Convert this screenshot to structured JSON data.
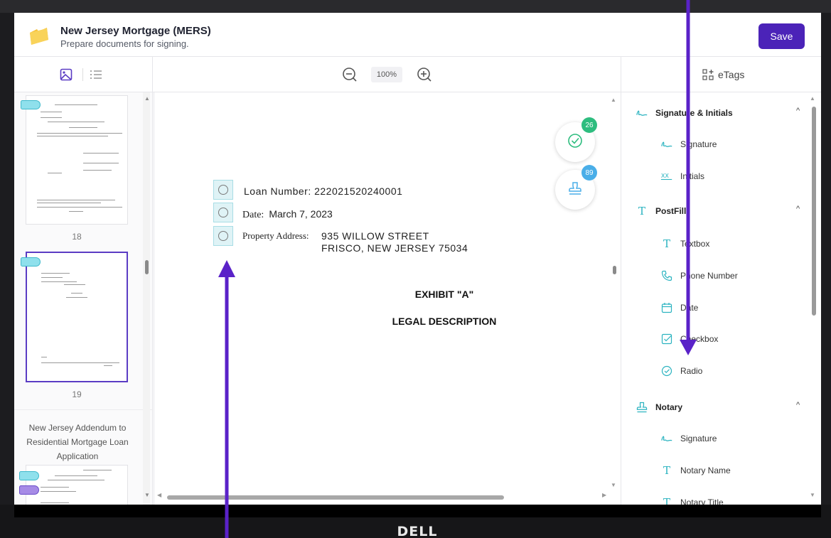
{
  "header": {
    "title": "New Jersey Mortgage (MERS)",
    "subtitle": "Prepare documents for signing.",
    "save_label": "Save"
  },
  "toolbar": {
    "zoom_level": "100%",
    "etags_label": "eTags"
  },
  "thumbnails": {
    "pages": [
      {
        "number": "18",
        "active": false
      },
      {
        "number": "19",
        "active": true
      }
    ],
    "document_title": "New Jersey Addendum to Residential Mortgage Loan Application"
  },
  "document": {
    "fields": [
      {
        "label": "Loan Number:",
        "value": "222021520240001"
      },
      {
        "label": "Date:",
        "value": "March 7, 2023"
      },
      {
        "label": "Property Address:",
        "value_line1": "935 WILLOW STREET",
        "value_line2": "FRISCO, NEW JERSEY 75034"
      }
    ],
    "exhibit_heading": "EXHIBIT \"A\"",
    "legal_heading": "LEGAL DESCRIPTION",
    "badges": {
      "check_count": "26",
      "stamp_count": "89"
    }
  },
  "etags_panel": {
    "sections": [
      {
        "title": "Signature & Initials",
        "icon": "signature-icon",
        "items": [
          {
            "label": "Signature",
            "icon": "signature-icon"
          },
          {
            "label": "Initials",
            "icon": "initials-icon"
          }
        ]
      },
      {
        "title": "PostFill",
        "icon": "text-icon",
        "items": [
          {
            "label": "Textbox",
            "icon": "text-icon"
          },
          {
            "label": "Phone Number",
            "icon": "phone-icon"
          },
          {
            "label": "Date",
            "icon": "calendar-icon"
          },
          {
            "label": "Checkbox",
            "icon": "checkbox-icon"
          },
          {
            "label": "Radio",
            "icon": "radio-icon"
          }
        ]
      },
      {
        "title": "Notary",
        "icon": "stamp-icon",
        "items": [
          {
            "label": "Signature",
            "icon": "signature-icon"
          },
          {
            "label": "Notary Name",
            "icon": "text-icon"
          },
          {
            "label": "Notary Title",
            "icon": "text-icon"
          }
        ]
      }
    ]
  },
  "device": {
    "brand": "DELL"
  },
  "colors": {
    "accent": "#4b23b8",
    "teal": "#2bb3c0",
    "badge_green": "#2ebd7f",
    "badge_blue": "#4aaee8",
    "annotation": "#5a22c8"
  }
}
